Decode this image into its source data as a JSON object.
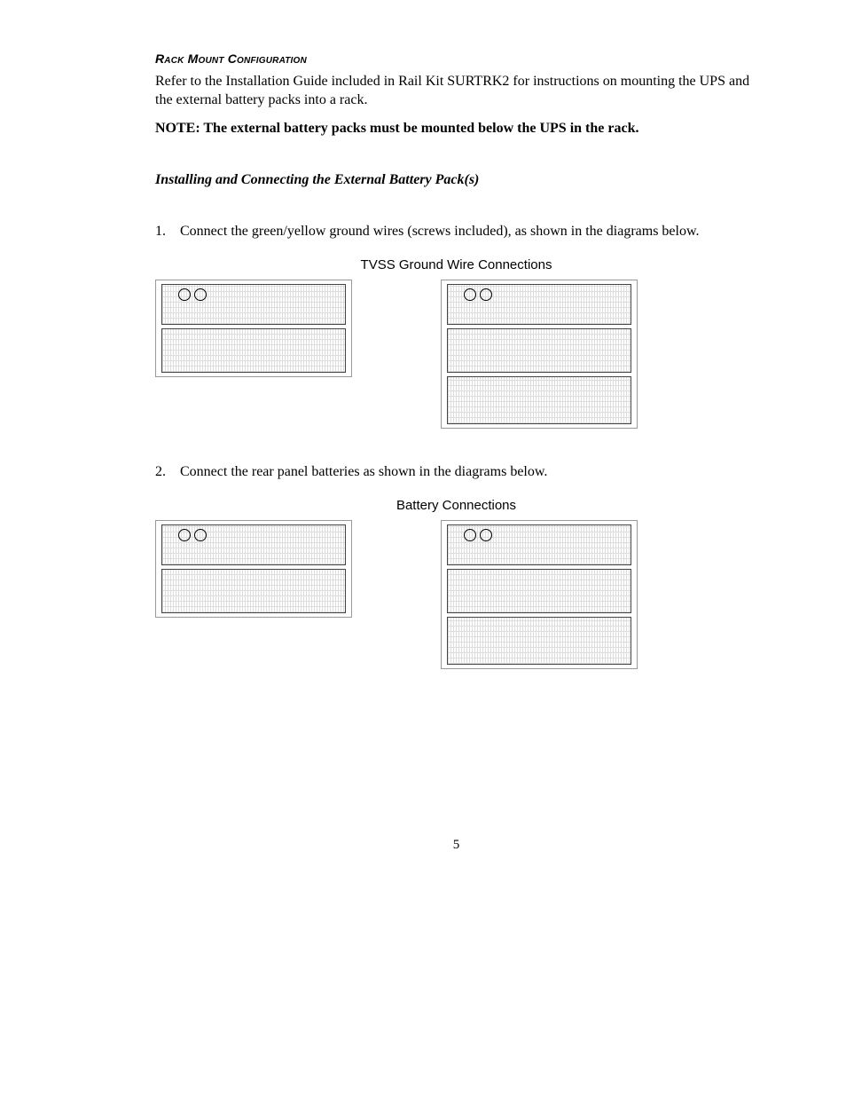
{
  "section_heading": "Rack Mount Configuration",
  "intro_para": "Refer to the Installation Guide included in Rail Kit SURTRK2 for instructions on mounting the UPS and the external battery packs into a rack.",
  "note": "NOTE:  The external battery packs must be mounted below the UPS in the rack.",
  "subheading": "Installing and Connecting the External Battery Pack(s)",
  "steps": [
    {
      "num": "1.",
      "text": "Connect the green/yellow ground wires (screws included), as shown in the diagrams below."
    },
    {
      "num": "2.",
      "text": "Connect the rear panel batteries as shown in the diagrams below."
    }
  ],
  "captions": {
    "tvss": "TVSS Ground Wire Connections",
    "battery": "Battery Connections"
  },
  "page_number": "5"
}
